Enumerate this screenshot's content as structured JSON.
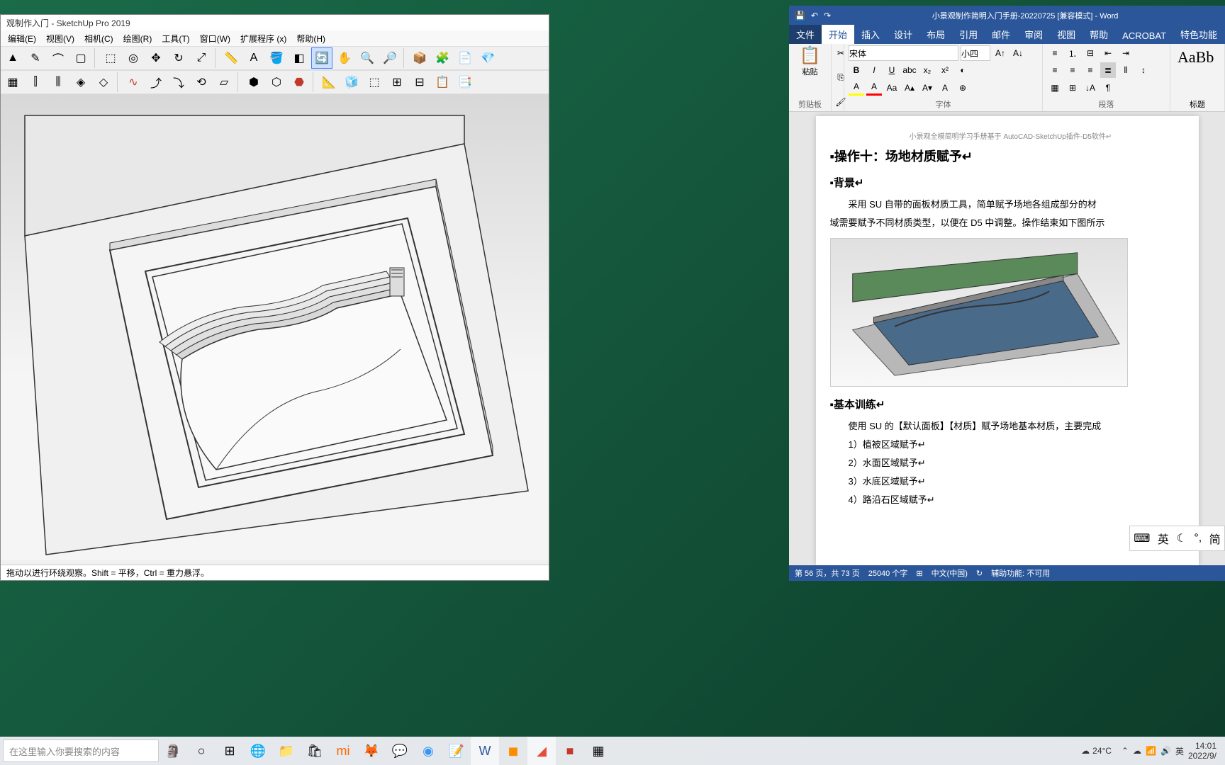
{
  "sketchup": {
    "title": "观制作入门 - SketchUp Pro 2019",
    "menu": [
      "编辑(E)",
      "视图(V)",
      "相机(C)",
      "绘图(R)",
      "工具(T)",
      "窗口(W)",
      "扩展程序 (x)",
      "帮助(H)"
    ],
    "status": "拖动以进行环绕观察。Shift = 平移，Ctrl = 重力悬浮。"
  },
  "word": {
    "title": "小景观制作简明入门手册-20220725 [兼容模式] - Word",
    "tabs": [
      "文件",
      "开始",
      "插入",
      "设计",
      "布局",
      "引用",
      "邮件",
      "审阅",
      "视图",
      "帮助",
      "ACROBAT",
      "特色功能"
    ],
    "active_tab": 1,
    "font_name": "宋体",
    "font_size": "小四",
    "groups": {
      "clipboard": "剪贴板",
      "paste": "粘贴",
      "font": "字体",
      "paragraph": "段落",
      "styles_preview": "AaBb",
      "style_name": "标题"
    },
    "doc": {
      "header": "小景观全模简明学习手册基于 AutoCAD-SketchUp插件-D5软件↵",
      "h1": "▪操作十：场地材质赋予↵",
      "h2_1": "▪背景↵",
      "p1": "采用 SU 自带的面板材质工具，简单赋予场地各组成部分的材",
      "p2": "域需要赋予不同材质类型，以便在 D5 中调整。操作结束如下图所示",
      "h2_2": "▪基本训练↵",
      "p3": "使用 SU 的【默认面板】【材质】赋予场地基本材质，主要完成",
      "li1": "1）植被区域赋予↵",
      "li2": "2）水面区域赋予↵",
      "li3": "3）水底区域赋予↵",
      "li4": "4）路沿石区域赋予↵"
    },
    "status": {
      "page": "第 56 页，共 73 页",
      "words": "25040 个字",
      "lang": "中文(中国)",
      "access": "辅助功能: 不可用"
    },
    "ime": {
      "lang": "英",
      "mode": "简"
    }
  },
  "taskbar": {
    "search_placeholder": "在这里输入你要搜索的内容",
    "weather_temp": "24°C",
    "tray_ime": "英",
    "time": "14:01",
    "date": "2022/9/"
  }
}
